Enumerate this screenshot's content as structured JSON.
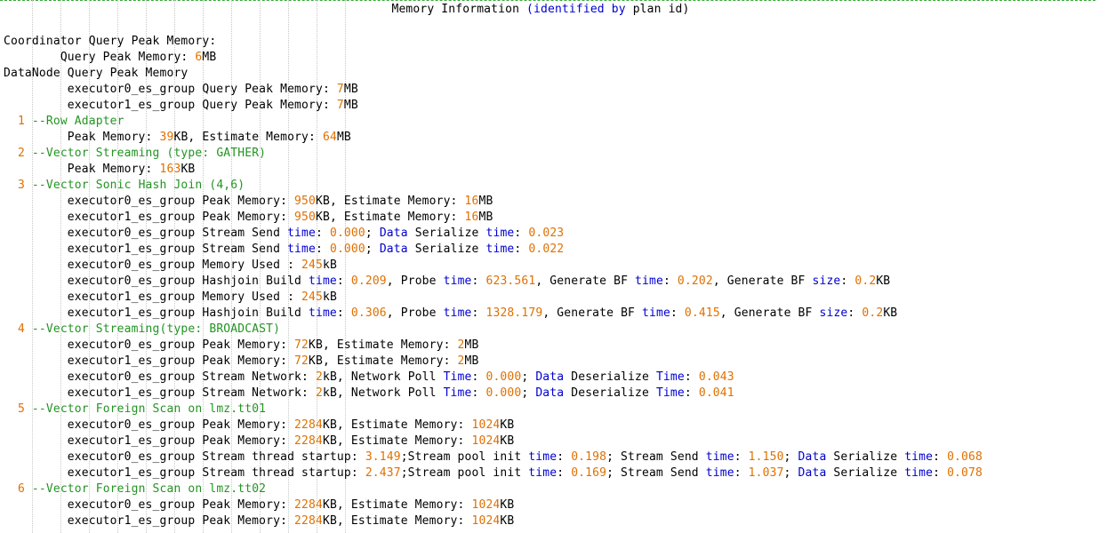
{
  "title": [
    {
      "t": "Memory Information ",
      "c": "plain"
    },
    {
      "t": "(identified by",
      "c": "kw"
    },
    {
      "t": " plan id)",
      "c": "plain"
    }
  ],
  "lines": [
    [
      {
        "t": "Coordinator Query Peak Memory:",
        "c": "plain"
      }
    ],
    [
      {
        "t": "        Query Peak Memory: ",
        "c": "plain"
      },
      {
        "t": "6",
        "c": "num"
      },
      {
        "t": "MB",
        "c": "plain"
      }
    ],
    [
      {
        "t": "DataNode Query Peak Memory",
        "c": "plain"
      }
    ],
    [
      {
        "t": "         executor0_es_group Query Peak Memory: ",
        "c": "plain"
      },
      {
        "t": "7",
        "c": "num"
      },
      {
        "t": "MB",
        "c": "plain"
      }
    ],
    [
      {
        "t": "         executor1_es_group Query Peak Memory: ",
        "c": "plain"
      },
      {
        "t": "7",
        "c": "num"
      },
      {
        "t": "MB",
        "c": "plain"
      }
    ],
    [
      {
        "t": "  1 ",
        "c": "num"
      },
      {
        "t": "--Row Adapter",
        "c": "op"
      }
    ],
    [
      {
        "t": "         Peak Memory: ",
        "c": "plain"
      },
      {
        "t": "39",
        "c": "num"
      },
      {
        "t": "KB, Estimate Memory: ",
        "c": "plain"
      },
      {
        "t": "64",
        "c": "num"
      },
      {
        "t": "MB",
        "c": "plain"
      }
    ],
    [
      {
        "t": "  2 ",
        "c": "num"
      },
      {
        "t": "--Vector Streaming (type: GATHER)",
        "c": "op"
      }
    ],
    [
      {
        "t": "         Peak Memory: ",
        "c": "plain"
      },
      {
        "t": "163",
        "c": "num"
      },
      {
        "t": "KB",
        "c": "plain"
      }
    ],
    [
      {
        "t": "  3 ",
        "c": "num"
      },
      {
        "t": "--Vector Sonic Hash Join (4,6)",
        "c": "op"
      }
    ],
    [
      {
        "t": "         executor0_es_group Peak Memory: ",
        "c": "plain"
      },
      {
        "t": "950",
        "c": "num"
      },
      {
        "t": "KB, Estimate Memory: ",
        "c": "plain"
      },
      {
        "t": "16",
        "c": "num"
      },
      {
        "t": "MB",
        "c": "plain"
      }
    ],
    [
      {
        "t": "         executor1_es_group Peak Memory: ",
        "c": "plain"
      },
      {
        "t": "950",
        "c": "num"
      },
      {
        "t": "KB, Estimate Memory: ",
        "c": "plain"
      },
      {
        "t": "16",
        "c": "num"
      },
      {
        "t": "MB",
        "c": "plain"
      }
    ],
    [
      {
        "t": "         executor0_es_group Stream Send ",
        "c": "plain"
      },
      {
        "t": "time",
        "c": "kw"
      },
      {
        "t": ": ",
        "c": "plain"
      },
      {
        "t": "0.000",
        "c": "num"
      },
      {
        "t": "; ",
        "c": "plain"
      },
      {
        "t": "Data",
        "c": "kw"
      },
      {
        "t": " Serialize ",
        "c": "plain"
      },
      {
        "t": "time",
        "c": "kw"
      },
      {
        "t": ": ",
        "c": "plain"
      },
      {
        "t": "0.023",
        "c": "num"
      }
    ],
    [
      {
        "t": "         executor1_es_group Stream Send ",
        "c": "plain"
      },
      {
        "t": "time",
        "c": "kw"
      },
      {
        "t": ": ",
        "c": "plain"
      },
      {
        "t": "0.000",
        "c": "num"
      },
      {
        "t": "; ",
        "c": "plain"
      },
      {
        "t": "Data",
        "c": "kw"
      },
      {
        "t": " Serialize ",
        "c": "plain"
      },
      {
        "t": "time",
        "c": "kw"
      },
      {
        "t": ": ",
        "c": "plain"
      },
      {
        "t": "0.022",
        "c": "num"
      }
    ],
    [
      {
        "t": "         executor0_es_group Memory Used : ",
        "c": "plain"
      },
      {
        "t": "245",
        "c": "num"
      },
      {
        "t": "kB",
        "c": "plain"
      }
    ],
    [
      {
        "t": "         executor0_es_group Hashjoin Build ",
        "c": "plain"
      },
      {
        "t": "time",
        "c": "kw"
      },
      {
        "t": ": ",
        "c": "plain"
      },
      {
        "t": "0.209",
        "c": "num"
      },
      {
        "t": ", Probe ",
        "c": "plain"
      },
      {
        "t": "time",
        "c": "kw"
      },
      {
        "t": ": ",
        "c": "plain"
      },
      {
        "t": "623.561",
        "c": "num"
      },
      {
        "t": ", Generate BF ",
        "c": "plain"
      },
      {
        "t": "time",
        "c": "kw"
      },
      {
        "t": ": ",
        "c": "plain"
      },
      {
        "t": "0.202",
        "c": "num"
      },
      {
        "t": ", Generate BF ",
        "c": "plain"
      },
      {
        "t": "size",
        "c": "kw"
      },
      {
        "t": ": ",
        "c": "plain"
      },
      {
        "t": "0.2",
        "c": "num"
      },
      {
        "t": "KB",
        "c": "plain"
      }
    ],
    [
      {
        "t": "         executor1_es_group Memory Used : ",
        "c": "plain"
      },
      {
        "t": "245",
        "c": "num"
      },
      {
        "t": "kB",
        "c": "plain"
      }
    ],
    [
      {
        "t": "         executor1_es_group Hashjoin Build ",
        "c": "plain"
      },
      {
        "t": "time",
        "c": "kw"
      },
      {
        "t": ": ",
        "c": "plain"
      },
      {
        "t": "0.306",
        "c": "num"
      },
      {
        "t": ", Probe ",
        "c": "plain"
      },
      {
        "t": "time",
        "c": "kw"
      },
      {
        "t": ": ",
        "c": "plain"
      },
      {
        "t": "1328.179",
        "c": "num"
      },
      {
        "t": ", Generate BF ",
        "c": "plain"
      },
      {
        "t": "time",
        "c": "kw"
      },
      {
        "t": ": ",
        "c": "plain"
      },
      {
        "t": "0.415",
        "c": "num"
      },
      {
        "t": ", Generate BF ",
        "c": "plain"
      },
      {
        "t": "size",
        "c": "kw"
      },
      {
        "t": ": ",
        "c": "plain"
      },
      {
        "t": "0.2",
        "c": "num"
      },
      {
        "t": "KB",
        "c": "plain"
      }
    ],
    [
      {
        "t": "  4 ",
        "c": "num"
      },
      {
        "t": "--Vector Streaming(type: BROADCAST)",
        "c": "op"
      }
    ],
    [
      {
        "t": "         executor0_es_group Peak Memory: ",
        "c": "plain"
      },
      {
        "t": "72",
        "c": "num"
      },
      {
        "t": "KB, Estimate Memory: ",
        "c": "plain"
      },
      {
        "t": "2",
        "c": "num"
      },
      {
        "t": "MB",
        "c": "plain"
      }
    ],
    [
      {
        "t": "         executor1_es_group Peak Memory: ",
        "c": "plain"
      },
      {
        "t": "72",
        "c": "num"
      },
      {
        "t": "KB, Estimate Memory: ",
        "c": "plain"
      },
      {
        "t": "2",
        "c": "num"
      },
      {
        "t": "MB",
        "c": "plain"
      }
    ],
    [
      {
        "t": "         executor0_es_group Stream Network: ",
        "c": "plain"
      },
      {
        "t": "2",
        "c": "num"
      },
      {
        "t": "kB, Network Poll ",
        "c": "plain"
      },
      {
        "t": "Time",
        "c": "kw"
      },
      {
        "t": ": ",
        "c": "plain"
      },
      {
        "t": "0.000",
        "c": "num"
      },
      {
        "t": "; ",
        "c": "plain"
      },
      {
        "t": "Data",
        "c": "kw"
      },
      {
        "t": " Deserialize ",
        "c": "plain"
      },
      {
        "t": "Time",
        "c": "kw"
      },
      {
        "t": ": ",
        "c": "plain"
      },
      {
        "t": "0.043",
        "c": "num"
      }
    ],
    [
      {
        "t": "         executor1_es_group Stream Network: ",
        "c": "plain"
      },
      {
        "t": "2",
        "c": "num"
      },
      {
        "t": "kB, Network Poll ",
        "c": "plain"
      },
      {
        "t": "Time",
        "c": "kw"
      },
      {
        "t": ": ",
        "c": "plain"
      },
      {
        "t": "0.000",
        "c": "num"
      },
      {
        "t": "; ",
        "c": "plain"
      },
      {
        "t": "Data",
        "c": "kw"
      },
      {
        "t": " Deserialize ",
        "c": "plain"
      },
      {
        "t": "Time",
        "c": "kw"
      },
      {
        "t": ": ",
        "c": "plain"
      },
      {
        "t": "0.041",
        "c": "num"
      }
    ],
    [
      {
        "t": "  5 ",
        "c": "num"
      },
      {
        "t": "--Vector Foreign Scan on lmz.tt01",
        "c": "op"
      }
    ],
    [
      {
        "t": "         executor0_es_group Peak Memory: ",
        "c": "plain"
      },
      {
        "t": "2284",
        "c": "num"
      },
      {
        "t": "KB, Estimate Memory: ",
        "c": "plain"
      },
      {
        "t": "1024",
        "c": "num"
      },
      {
        "t": "KB",
        "c": "plain"
      }
    ],
    [
      {
        "t": "         executor1_es_group Peak Memory: ",
        "c": "plain"
      },
      {
        "t": "2284",
        "c": "num"
      },
      {
        "t": "KB, Estimate Memory: ",
        "c": "plain"
      },
      {
        "t": "1024",
        "c": "num"
      },
      {
        "t": "KB",
        "c": "plain"
      }
    ],
    [
      {
        "t": "         executor0_es_group Stream thread startup: ",
        "c": "plain"
      },
      {
        "t": "3.149",
        "c": "num"
      },
      {
        "t": ";Stream pool init ",
        "c": "plain"
      },
      {
        "t": "time",
        "c": "kw"
      },
      {
        "t": ": ",
        "c": "plain"
      },
      {
        "t": "0.198",
        "c": "num"
      },
      {
        "t": "; Stream Send ",
        "c": "plain"
      },
      {
        "t": "time",
        "c": "kw"
      },
      {
        "t": ": ",
        "c": "plain"
      },
      {
        "t": "1.150",
        "c": "num"
      },
      {
        "t": "; ",
        "c": "plain"
      },
      {
        "t": "Data",
        "c": "kw"
      },
      {
        "t": " Serialize ",
        "c": "plain"
      },
      {
        "t": "time",
        "c": "kw"
      },
      {
        "t": ": ",
        "c": "plain"
      },
      {
        "t": "0.068",
        "c": "num"
      }
    ],
    [
      {
        "t": "         executor1_es_group Stream thread startup: ",
        "c": "plain"
      },
      {
        "t": "2.437",
        "c": "num"
      },
      {
        "t": ";Stream pool init ",
        "c": "plain"
      },
      {
        "t": "time",
        "c": "kw"
      },
      {
        "t": ": ",
        "c": "plain"
      },
      {
        "t": "0.169",
        "c": "num"
      },
      {
        "t": "; Stream Send ",
        "c": "plain"
      },
      {
        "t": "time",
        "c": "kw"
      },
      {
        "t": ": ",
        "c": "plain"
      },
      {
        "t": "1.037",
        "c": "num"
      },
      {
        "t": "; ",
        "c": "plain"
      },
      {
        "t": "Data",
        "c": "kw"
      },
      {
        "t": " Serialize ",
        "c": "plain"
      },
      {
        "t": "time",
        "c": "kw"
      },
      {
        "t": ": ",
        "c": "plain"
      },
      {
        "t": "0.078",
        "c": "num"
      }
    ],
    [
      {
        "t": "  6 ",
        "c": "num"
      },
      {
        "t": "--Vector Foreign Scan on lmz.tt02",
        "c": "op"
      }
    ],
    [
      {
        "t": "         executor0_es_group Peak Memory: ",
        "c": "plain"
      },
      {
        "t": "2284",
        "c": "num"
      },
      {
        "t": "KB, Estimate Memory: ",
        "c": "plain"
      },
      {
        "t": "1024",
        "c": "num"
      },
      {
        "t": "KB",
        "c": "plain"
      }
    ],
    [
      {
        "t": "         executor1_es_group Peak Memory: ",
        "c": "plain"
      },
      {
        "t": "2284",
        "c": "num"
      },
      {
        "t": "KB, Estimate Memory: ",
        "c": "plain"
      },
      {
        "t": "1024",
        "c": "num"
      },
      {
        "t": "KB",
        "c": "plain"
      }
    ]
  ],
  "colors": {
    "number": "#e07000",
    "keyword": "#0000d0",
    "operator": "#239423",
    "text": "#000000",
    "separator": "#3aa83a"
  }
}
